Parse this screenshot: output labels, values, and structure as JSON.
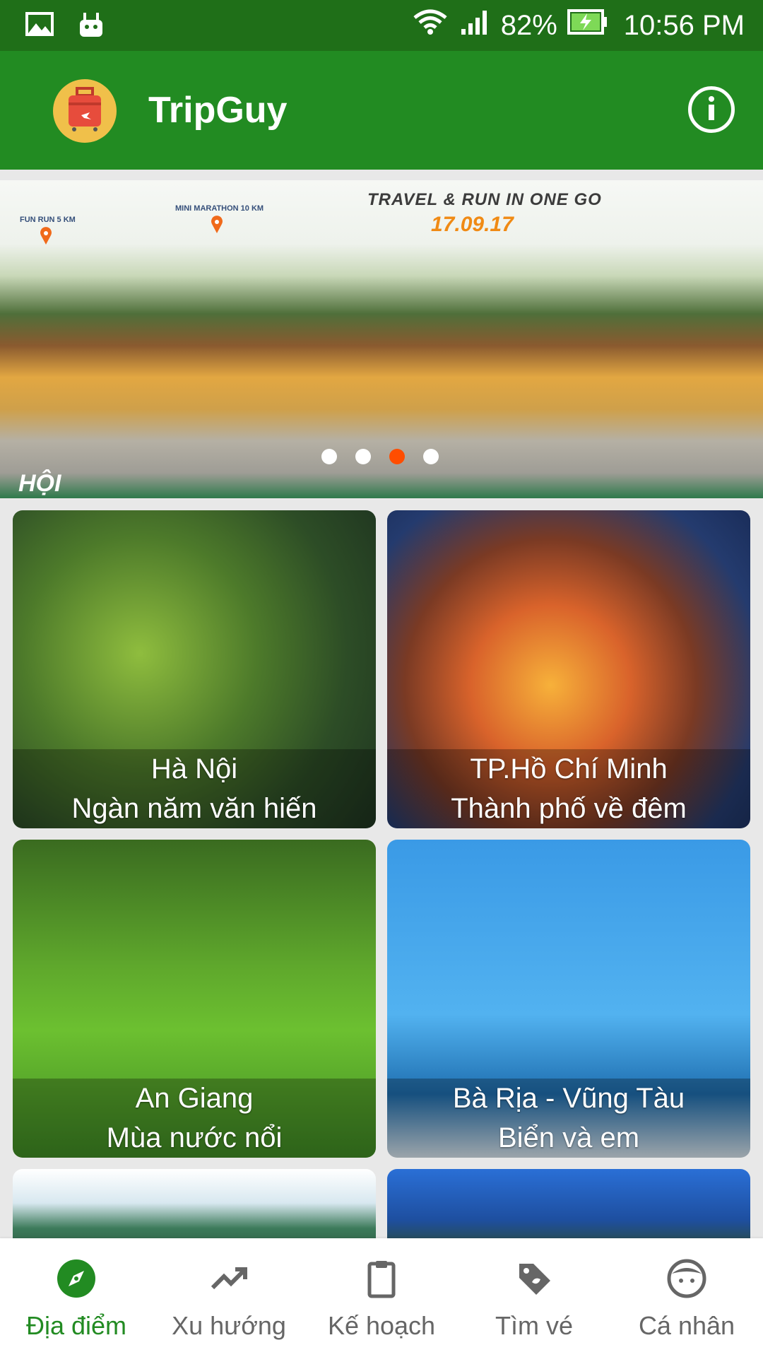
{
  "status_bar": {
    "battery": "82%",
    "time": "10:56 PM"
  },
  "app_bar": {
    "title": "TripGuy"
  },
  "banner": {
    "headline": "TRAVEL & RUN IN ONE GO",
    "date": "17.09.17",
    "pin1": "FUN RUN 5 KM",
    "pin2": "MINI MARATHON 10 KM",
    "corner_text": "HỘI",
    "active_index": 3,
    "total": 4
  },
  "destinations": [
    {
      "name": "Hà Nội",
      "subtitle": "Ngàn năm văn hiến"
    },
    {
      "name": "TP.Hồ Chí Minh",
      "subtitle": "Thành phố về đêm"
    },
    {
      "name": "An Giang",
      "subtitle": "Mùa nước nổi"
    },
    {
      "name": "Bà Rịa - Vũng Tàu",
      "subtitle": "Biển và em"
    }
  ],
  "bottom_nav": [
    {
      "label": "Địa điểm",
      "icon": "compass-icon",
      "active": true
    },
    {
      "label": "Xu hướng",
      "icon": "trending-icon",
      "active": false
    },
    {
      "label": "Kế hoạch",
      "icon": "clipboard-icon",
      "active": false
    },
    {
      "label": "Tìm vé",
      "icon": "ticket-tag-icon",
      "active": false
    },
    {
      "label": "Cá nhân",
      "icon": "face-icon",
      "active": false
    }
  ],
  "colors": {
    "primary": "#228b22",
    "status_bar": "#1f6f18",
    "active_dot": "#ff4d00"
  }
}
